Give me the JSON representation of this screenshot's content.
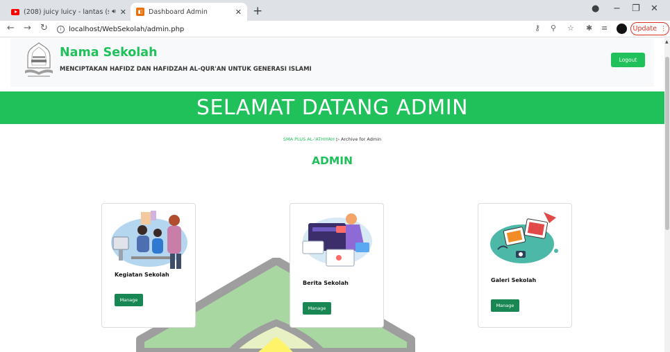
{
  "browser": {
    "tabs": [
      {
        "title": "(208) juicy luicy - lantas (spe",
        "favicon": "youtube-icon",
        "audio": true
      },
      {
        "title": "Dashboard Admin",
        "favicon": "dashboard-icon",
        "active": true
      }
    ],
    "url": "localhost/WebSekolah/admin.php",
    "update_label": "Update",
    "accent_update": "#d93025"
  },
  "header": {
    "school_name": "Nama Sekolah",
    "tagline": "MENCIPTAKAN HAFIDZ DAN HAFIDZAH AL-QUR'AN UNTUK GENERASI ISLAMI",
    "logout_label": "Logout"
  },
  "banner": {
    "text": "SELAMAT DATANG ADMIN"
  },
  "breadcrumb": {
    "home": "SMA PLUS AL-'ATHIYAH",
    "current": "Archive for Admin"
  },
  "section_title": "ADMIN",
  "cards": [
    {
      "title": "Kegiatan Sekolah",
      "button": "Manage"
    },
    {
      "title": "Berita Sekolah",
      "button": "Manage"
    },
    {
      "title": "Galeri Sekolah",
      "button": "Manage"
    }
  ],
  "colors": {
    "brand_green": "#20c05a",
    "button_green": "#198754",
    "header_bg": "#f8f9fa"
  }
}
